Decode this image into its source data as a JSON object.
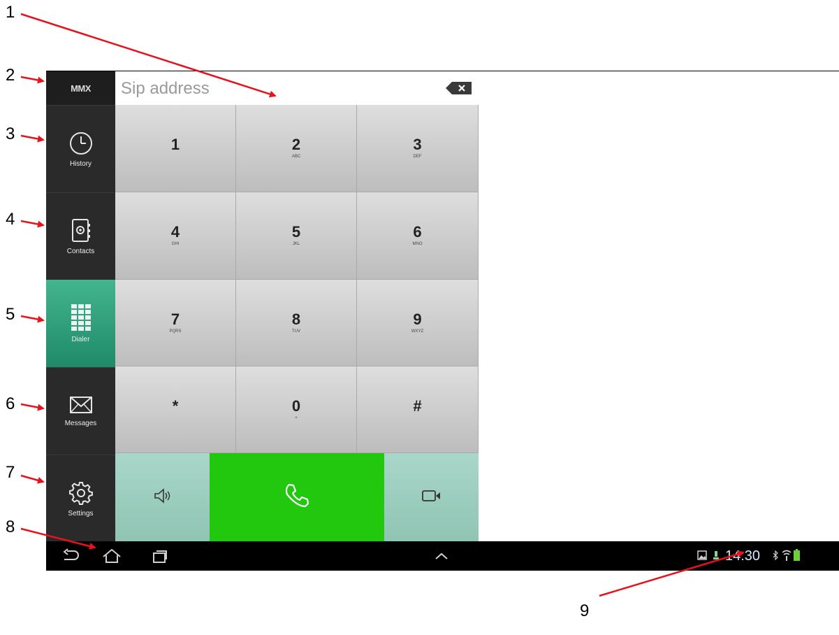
{
  "callouts": [
    "1",
    "2",
    "3",
    "4",
    "5",
    "6",
    "7",
    "8",
    "9"
  ],
  "brand": "MMX",
  "address": {
    "placeholder": "Sip address",
    "value": ""
  },
  "sidebar": {
    "items": [
      {
        "label": "History",
        "icon": "clock-icon",
        "active": false
      },
      {
        "label": "Contacts",
        "icon": "contacts-book-icon",
        "active": false
      },
      {
        "label": "Dialer",
        "icon": "dialpad-icon",
        "active": true
      },
      {
        "label": "Messages",
        "icon": "envelope-icon",
        "active": false
      },
      {
        "label": "Settings",
        "icon": "gear-icon",
        "active": false
      }
    ]
  },
  "keypad": {
    "keys": [
      {
        "digit": "1",
        "letters": ""
      },
      {
        "digit": "2",
        "letters": "ABC"
      },
      {
        "digit": "3",
        "letters": "DEF"
      },
      {
        "digit": "4",
        "letters": "GHI"
      },
      {
        "digit": "5",
        "letters": "JKL"
      },
      {
        "digit": "6",
        "letters": "MNO"
      },
      {
        "digit": "7",
        "letters": "PQRS"
      },
      {
        "digit": "8",
        "letters": "TUV"
      },
      {
        "digit": "9",
        "letters": "WXYZ"
      },
      {
        "digit": "*",
        "letters": ""
      },
      {
        "digit": "0",
        "letters": "+"
      },
      {
        "digit": "#",
        "letters": ""
      }
    ]
  },
  "actions": [
    "speaker-icon",
    "phone-call-icon",
    "video-camera-icon"
  ],
  "statusbar": {
    "time": "14:30"
  },
  "colors": {
    "sidebar": "#2a2a2a",
    "active_tab": "#2ea37d",
    "call_button": "#22c80e",
    "secondary_buttons": "#9fcfc0",
    "arrows": "#e8121c"
  }
}
